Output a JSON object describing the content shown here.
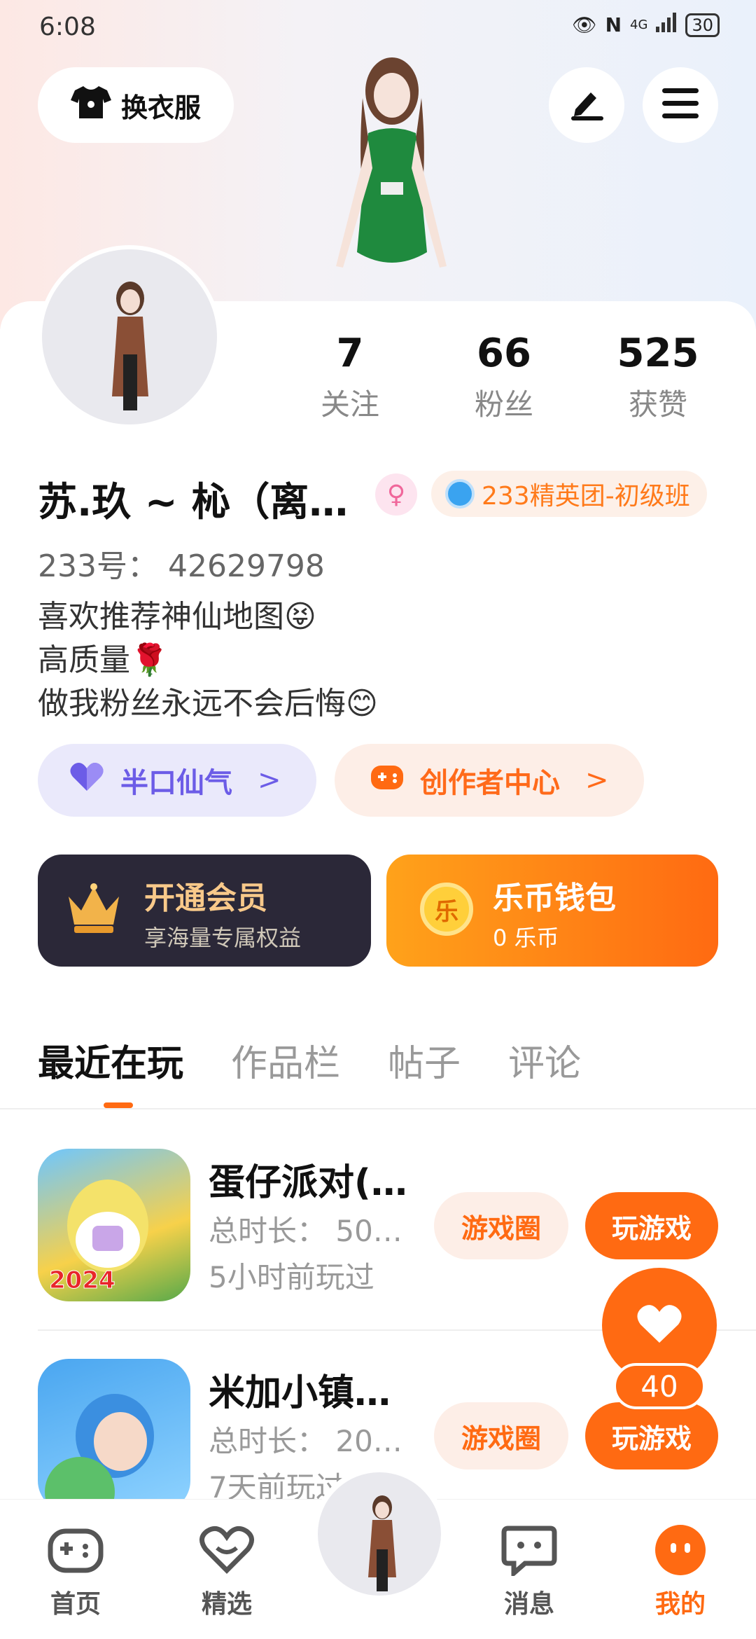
{
  "status_bar": {
    "time": "6:08",
    "network": "4G",
    "battery": "30"
  },
  "header": {
    "dress_up_label": "换衣服"
  },
  "stats": [
    {
      "value": "7",
      "label": "关注"
    },
    {
      "value": "66",
      "label": "粉丝"
    },
    {
      "value": "525",
      "label": "获赞"
    }
  ],
  "profile": {
    "name": "苏.玖 ~ 杺（离…",
    "gender_symbol": "♀",
    "badge_label": "233精英团-初级班",
    "uid": "233号：  42629798",
    "bio": [
      "喜欢推荐神仙地图😝",
      "高质量🌹",
      "做我粉丝永远不会后悔😊"
    ]
  },
  "chips": [
    {
      "label": "半口仙气",
      "arrow": ">"
    },
    {
      "label": "创作者中心",
      "arrow": ">"
    }
  ],
  "cards": {
    "vip": {
      "title": "开通会员",
      "subtitle": "享海量专属权益"
    },
    "wallet": {
      "title": "乐币钱包",
      "subtitle": "0 乐币",
      "coin_char": "乐"
    }
  },
  "tabs": [
    {
      "label": "最近在玩",
      "active": true
    },
    {
      "label": "作品栏",
      "active": false
    },
    {
      "label": "帖子",
      "active": false
    },
    {
      "label": "评论",
      "active": false
    }
  ],
  "games": [
    {
      "title": "蛋仔派对(…",
      "duration": "总时长：  50…",
      "last_played": "5小时前玩过",
      "circle_btn": "游戏圈",
      "play_btn": "玩游戏",
      "year_badge": "2024"
    },
    {
      "title": "米加小镇…",
      "duration": "总时长：  20…",
      "last_played": "7天前玩过",
      "circle_btn": "游戏圈",
      "play_btn": "玩游戏"
    }
  ],
  "fab": {
    "count": "40"
  },
  "bottom_nav": [
    {
      "label": "首页",
      "active": false
    },
    {
      "label": "精选",
      "active": false
    },
    {
      "label": "消息",
      "active": false
    },
    {
      "label": "我的",
      "active": true
    }
  ],
  "colors": {
    "accent": "#ff6a12",
    "purple": "#6c5ce7",
    "dark_card": "#2b2838"
  }
}
